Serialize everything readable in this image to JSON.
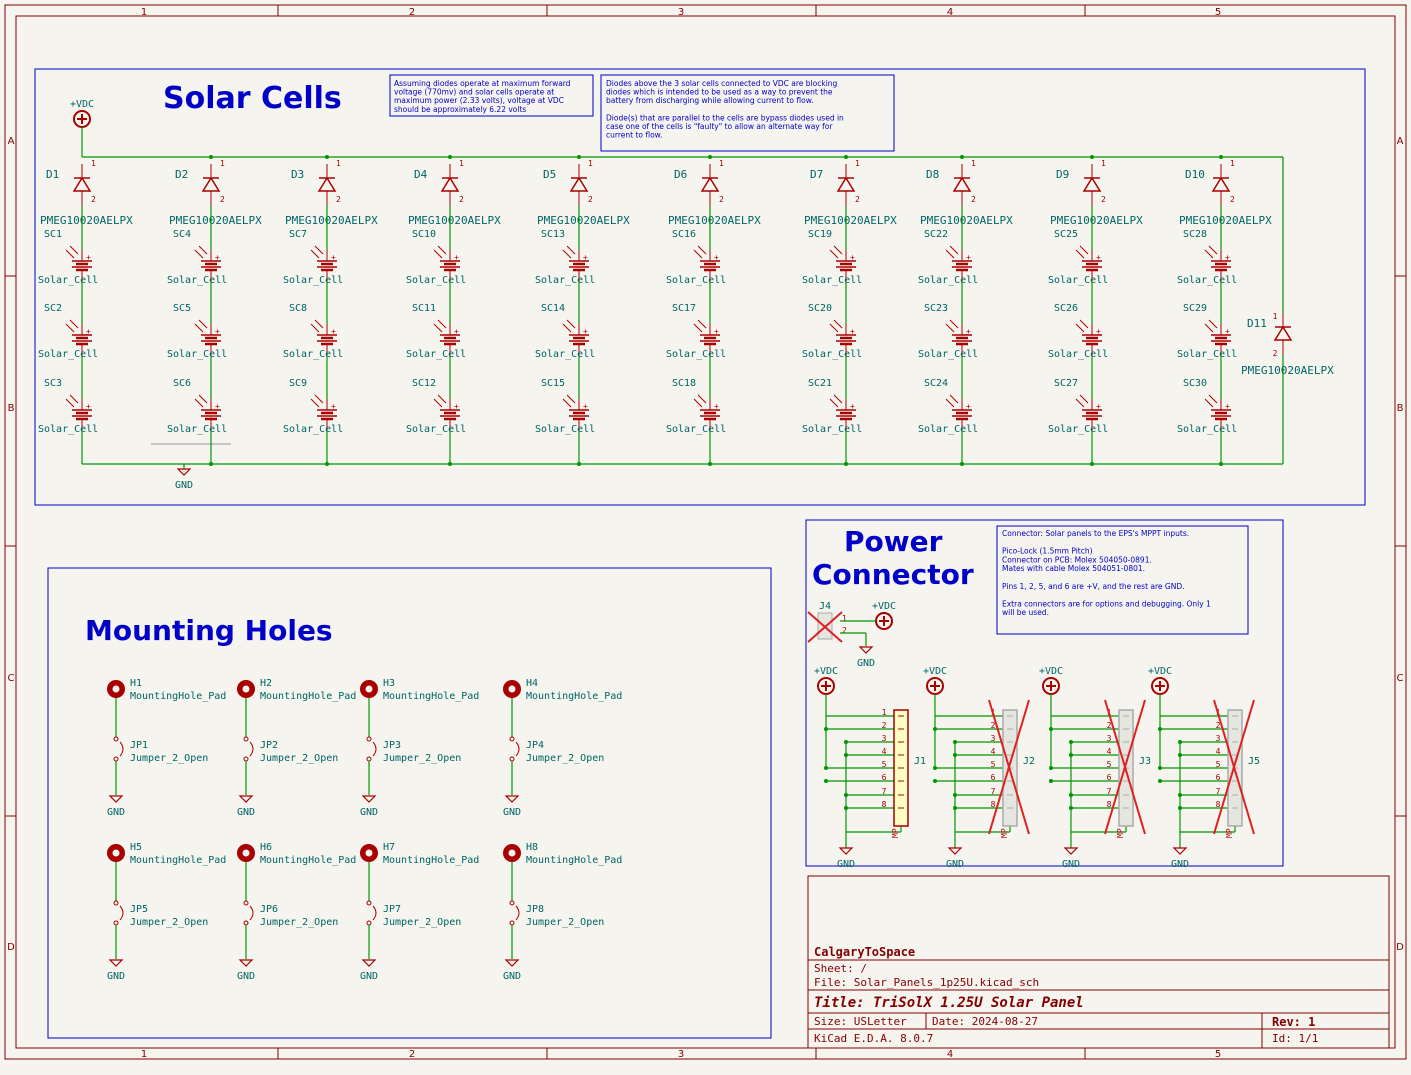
{
  "border": {
    "columns": [
      "1",
      "2",
      "3",
      "4",
      "5"
    ],
    "rows": [
      "A",
      "B",
      "C",
      "D"
    ]
  },
  "solar_cells": {
    "title": "Solar Cells",
    "note1": [
      "Assuming diodes operate at maximum forward",
      "voltage (770mv) and solar cells operate at",
      "maximum power (2.33 volts), voltage at VDC",
      "should be approximately 6.22 volts"
    ],
    "note2": [
      "Diodes above the 3 solar cells connected to VDC are blocking",
      "diodes which is intended to be used as a way to prevent the",
      "battery from discharging while allowing current to flow.",
      "",
      "Diode(s) that are parallel to the cells are bypass diodes used in",
      "case one of the cells is \"faulty\" to allow an alternate way for",
      "current to flow."
    ],
    "vdc_label": "+VDC",
    "gnd_label": "GND",
    "diode_value": "PMEG10020AELPX",
    "cell_value": "Solar_Cell",
    "diodes": [
      "D1",
      "D2",
      "D3",
      "D4",
      "D5",
      "D6",
      "D7",
      "D8",
      "D9",
      "D10"
    ],
    "bypass_diode": "D11",
    "cells": [
      [
        "SC1",
        "SC2",
        "SC3"
      ],
      [
        "SC4",
        "SC5",
        "SC6"
      ],
      [
        "SC7",
        "SC8",
        "SC9"
      ],
      [
        "SC10",
        "SC11",
        "SC12"
      ],
      [
        "SC13",
        "SC14",
        "SC15"
      ],
      [
        "SC16",
        "SC17",
        "SC18"
      ],
      [
        "SC19",
        "SC20",
        "SC21"
      ],
      [
        "SC22",
        "SC23",
        "SC24"
      ],
      [
        "SC25",
        "SC26",
        "SC27"
      ],
      [
        "SC28",
        "SC29",
        "SC30"
      ]
    ],
    "pin_1": "1",
    "pin_2": "2"
  },
  "mounting_holes": {
    "title": "Mounting Holes",
    "hole_value": "MountingHole_Pad",
    "jumper_value": "Jumper_2_Open",
    "gnd_label": "GND",
    "holes": [
      "H1",
      "H2",
      "H3",
      "H4",
      "H5",
      "H6",
      "H7",
      "H8"
    ],
    "jumpers": [
      "JP1",
      "JP2",
      "JP3",
      "JP4",
      "JP5",
      "JP6",
      "JP7",
      "JP8"
    ]
  },
  "power_connector": {
    "title_line1": "Power",
    "title_line2": "Connector",
    "note": [
      "Connector: Solar panels to the EPS's MPPT inputs.",
      "",
      "Pico-Lock (1.5mm Pitch)",
      "    Connector on PCB: Molex 504050-0891.",
      "    Mates with cable Molex 504051-0801.",
      "",
      "Pins 1, 2, 5, and 6 are +V, and the rest are GND.",
      "",
      "Extra connectors are for options and debugging. Only 1",
      "will be used."
    ],
    "vdc_label": "+VDC",
    "gnd_label": "GND",
    "j4": "J4",
    "j4_pins": [
      "1",
      "2"
    ],
    "connectors": [
      "J1",
      "J2",
      "J3",
      "J5"
    ],
    "pins": [
      "1",
      "2",
      "3",
      "4",
      "5",
      "6",
      "7",
      "8"
    ],
    "mp_label": "MP"
  },
  "title_block": {
    "company": "CalgaryToSpace",
    "sheet": "Sheet: /",
    "file": "File: Solar_Panels_1p25U.kicad_sch",
    "title": "Title: TriSolX 1.25U Solar Panel",
    "size": "Size: USLetter",
    "date": "Date: 2024-08-27",
    "rev": "Rev: 1",
    "tool": "KiCad E.D.A. 8.0.7",
    "id": "Id: 1/1"
  },
  "colors": {
    "wire": "#009600",
    "symbol": "#a90000",
    "frame": "#840000",
    "text_blue": "#0000c8",
    "ref_text": "#006464"
  }
}
